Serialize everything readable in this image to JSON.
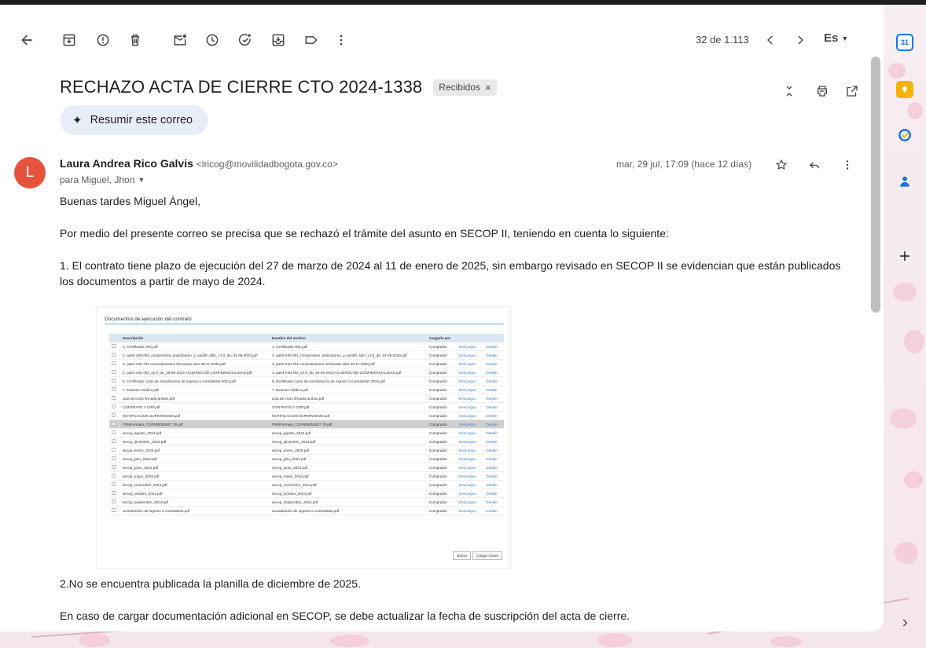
{
  "toolbar": {
    "counter": "32 de 1.113",
    "language": "Es"
  },
  "email": {
    "subject": "RECHAZO ACTA DE CIERRE CTO 2024-1338",
    "label": "Recibidos",
    "label_close": "×",
    "summarize_label": "Resumir este correo",
    "avatar_letter": "L",
    "sender_name": "Laura Andrea Rico Galvis",
    "sender_email": "<lricog@movilidadbogota.gov.co>",
    "recipients": "para Miguel, Jhon",
    "date": "mar, 29 jul, 17:09 (hace 12 días)",
    "paragraphs": [
      "Buenas tardes Miguel Ángel,",
      "Por medio del presente correo se precisa que se rechazó el trámite del asunto en SECOP II, teniendo en cuenta lo siguiente:",
      "1. El contrato tiene plazo de ejecución del 27 de marzo de 2024 al 11 de enero de 2025, sin embargo revisado en SECOP II se evidencian que están publicados los documentos a partir de mayo de 2024.",
      "2.No se encuentra publicada la planilla de diciembre de 2025.",
      "En caso de cargar documentación adicional en SECOP, se debe actualizar la fecha de suscripción del acta de cierre."
    ]
  },
  "attachment_image": {
    "title": "Documentos de ejecución del contrato",
    "headers": [
      "Descripción",
      "Nombre del archivo",
      "Cargado por"
    ],
    "action_download": "Descargar",
    "action_detail": "Detalle",
    "rows": [
      {
        "desc": "1. Certificado ARL.pdf",
        "file": "1. Certificado ARL.pdf",
        "by": "Comprador"
      },
      {
        "desc": "2. pa02-m03-f01_compromiso_antisoborno_y_sarlaft_sdm_v1.0_de_31-05-2023.pdf",
        "file": "2. pa02-m03-f01_compromiso_antisoborno_y_sarlaft_sdm_v1.0_de_31-05-2023.pdf",
        "by": "Comprador"
      },
      {
        "desc": "3. pa01-m01-f01-consentimiento-informado-sdm-26-11-2020.pdf",
        "file": "3. pa01-m01-f01-consentimiento-informado-sdm-26-11-2020.pdf",
        "by": "Comprador"
      },
      {
        "desc": "4. pa04-m01-f02_v2.0_de_28-08-2023 ACUERDO DE CONFIDENCIALIDAD.pdf",
        "file": "4. pa04-m01-f02_v2.0_de_28-08-2023 ACUERDO DE CONFIDENCIALIDAD.pdf",
        "by": "Comprador"
      },
      {
        "desc": "6. Certificado curso de socialización de ingreso a contratistas 2024.pdf",
        "file": "6. Certificado curso de socialización de ingreso a contratistas 2024.pdf",
        "by": "Comprador"
      },
      {
        "desc": "7. Examen médico.pdf",
        "file": "7. Examen médico.pdf",
        "by": "Comprador"
      },
      {
        "desc": "acta de inicio firmada ambos.pdf",
        "file": "acta de inicio firmada ambos.pdf",
        "by": "Comprador"
      },
      {
        "desc": "CONTRATO Y CRP.pdf",
        "file": "CONTRATO Y CRP.pdf",
        "by": "Comprador"
      },
      {
        "desc": "NOTIFICACION SUPERVISION.pdf",
        "file": "NOTIFICACION SUPERVISION.pdf",
        "by": "Comprador"
      },
      {
        "desc": "PSMFormato_COP000053627 79.pdf",
        "file": "PSMFormato_COP000053627 79.pdf",
        "by": "Comprador"
      },
      {
        "desc": "secop_agosto_2024.pdf",
        "file": "secop_agosto_2024.pdf",
        "by": "Comprador"
      },
      {
        "desc": "secop_diciembre_2024.pdf",
        "file": "secop_diciembre_2024.pdf",
        "by": "Comprador"
      },
      {
        "desc": "secop_enero_2025.pdf",
        "file": "secop_enero_2025.pdf",
        "by": "Comprador"
      },
      {
        "desc": "secop_julio_2024.pdf",
        "file": "secop_julio_2024.pdf",
        "by": "Comprador"
      },
      {
        "desc": "secop_junio_2024.pdf",
        "file": "secop_junio_2024.pdf",
        "by": "Comprador"
      },
      {
        "desc": "secop_mayo_2024.pdf",
        "file": "secop_mayo_2024.pdf",
        "by": "Comprador"
      },
      {
        "desc": "secop_noviembre_2024.pdf",
        "file": "secop_noviembre_2024.pdf",
        "by": "Comprador"
      },
      {
        "desc": "secop_octubre_2024.pdf",
        "file": "secop_octubre_2024.pdf",
        "by": "Comprador"
      },
      {
        "desc": "secop_septiembre_2024.pdf",
        "file": "secop_septiembre_2024.pdf",
        "by": "Comprador"
      },
      {
        "desc": "socialización de ingreso a contratistas.pdf",
        "file": "socialización de ingreso a contratistas.pdf",
        "by": "Comprador"
      }
    ],
    "highlighted_row": 9,
    "buttons": [
      "Borrar",
      "Cargar nuevo"
    ]
  },
  "colors": {
    "avatar": "#e5533d",
    "link": "#3d7fc1",
    "summarize_bg": "#e8eef7"
  },
  "side_panel": {
    "calendar_day": "31"
  }
}
